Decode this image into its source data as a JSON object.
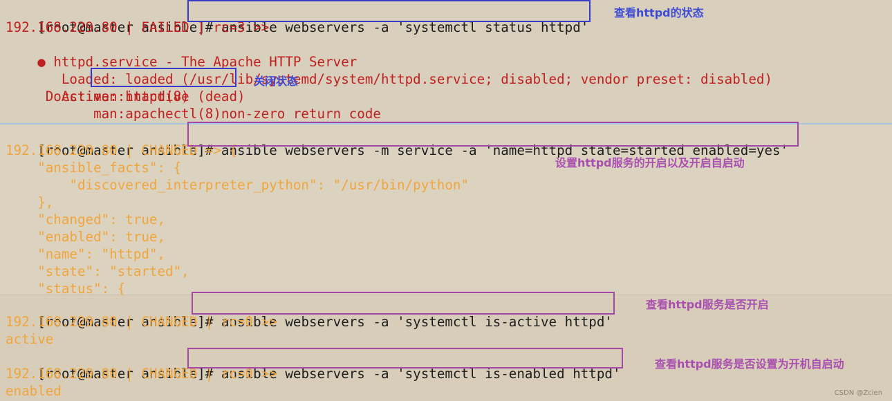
{
  "block1": {
    "prompt": "[root@master ansible]#",
    "command": " ansible webservers -a 'systemctl status httpd'",
    "host_line": "192.168.229.80 | FAILED | rc=3 >>",
    "service_dot": "●",
    "service_line": " httpd.service - The Apache HTTP Server",
    "loaded_label": "   Loaded: ",
    "loaded_value": "loaded (/usr/lib/systemd/system/httpd.service; disabled; vendor preset: disabled)",
    "active_label": "   Active: ",
    "active_value": "inactive (dead)",
    "docs_line1": "     Docs: man:httpd(8)",
    "docs_line2": "           man:apachectl(8)non-zero return code",
    "note_status": "查看httpd的状态",
    "note_inactive": "关闭状态"
  },
  "block2": {
    "prompt": "[root@master ansible]#",
    "command": " ansible webservers -m service -a 'name=httpd state=started enabled=yes'",
    "lines": [
      "192.168.229.80 | CHANGED => {",
      "    \"ansible_facts\": {",
      "        \"discovered_interpreter_python\": \"/usr/bin/python\"",
      "    },",
      "    \"changed\": true,",
      "    \"enabled\": true,",
      "    \"name\": \"httpd\",",
      "    \"state\": \"started\",",
      "    \"status\": {"
    ],
    "note": "设置httpd服务的开启以及开启自启动"
  },
  "block3": {
    "prompt1": "[root@master ansible]#",
    "command1": " ansible webservers -a 'systemctl is-active httpd'",
    "result1_host": "192.168.229.80 | CHANGED | rc=0 >>",
    "result1_value": "active",
    "note1": "查看httpd服务是否开启",
    "prompt2": "[root@master ansible]#",
    "command2": " ansible webservers -a 'systemctl is-enabled httpd'",
    "result2_host": "192.168.229.80 | CHANGED | rc=0 >>",
    "result2_value": "enabled",
    "note2": "查看httpd服务是否设置为开机自启动"
  },
  "watermark": "CSDN @Zcien",
  "colors": {
    "error_red": "#c0201f",
    "changed_orange": "#f0a63c",
    "box_blue": "#3a39c9",
    "box_purple": "#a448a8"
  }
}
